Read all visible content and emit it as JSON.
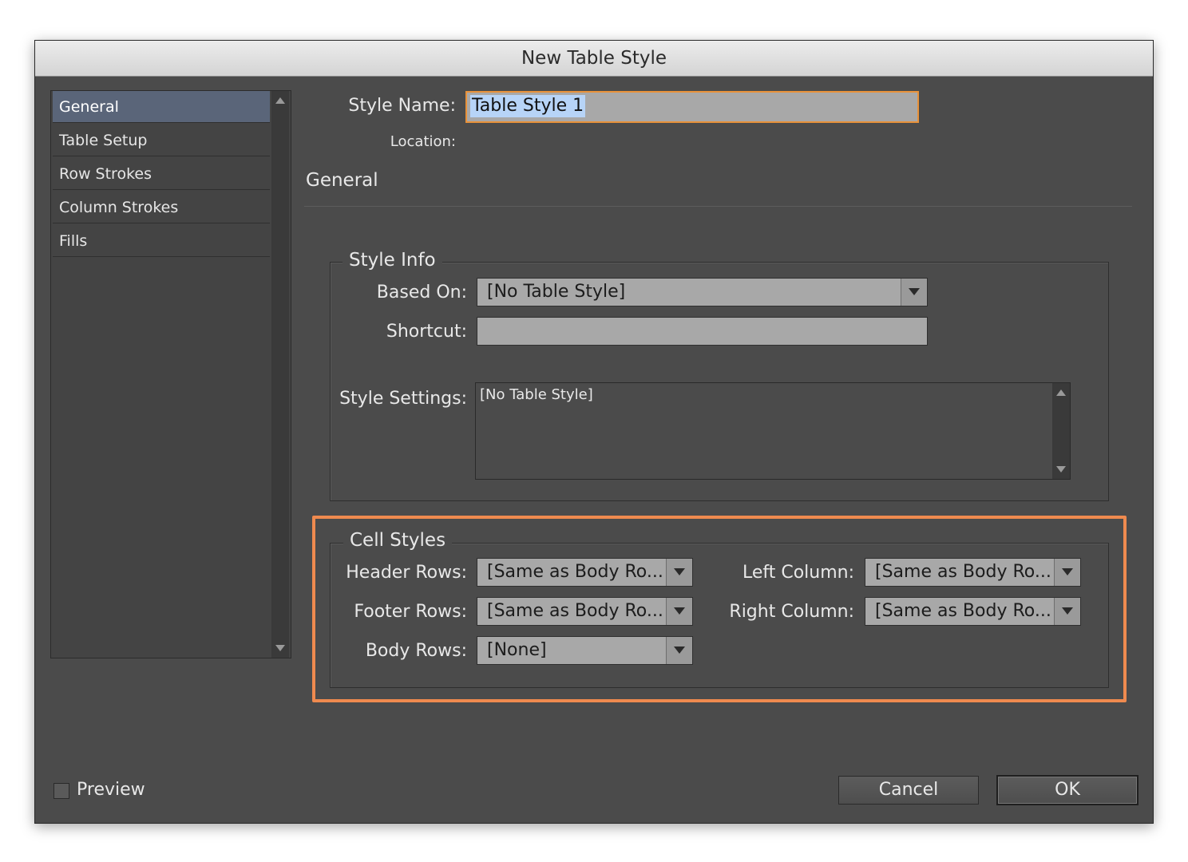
{
  "window": {
    "title": "New Table Style"
  },
  "sidebar": {
    "items": [
      {
        "label": "General",
        "active": true
      },
      {
        "label": "Table Setup"
      },
      {
        "label": "Row Strokes"
      },
      {
        "label": "Column Strokes"
      },
      {
        "label": "Fills"
      }
    ]
  },
  "style_name": {
    "label": "Style Name:",
    "value": "Table Style 1"
  },
  "location": {
    "label": "Location:"
  },
  "section": {
    "title": "General"
  },
  "style_info": {
    "legend": "Style Info",
    "based_on_label": "Based On:",
    "based_on_value": "[No Table Style]",
    "shortcut_label": "Shortcut:",
    "shortcut_value": "",
    "settings_label": "Style Settings:",
    "settings_value": "[No Table Style]"
  },
  "cell_styles": {
    "legend": "Cell Styles",
    "header_rows_label": "Header Rows:",
    "header_rows_value": "[Same as Body Ro...",
    "footer_rows_label": "Footer Rows:",
    "footer_rows_value": "[Same as Body Ro...",
    "body_rows_label": "Body Rows:",
    "body_rows_value": "[None]",
    "left_column_label": "Left Column:",
    "left_column_value": "[Same as Body Ro...",
    "right_column_label": "Right Column:",
    "right_column_value": "[Same as Body Ro..."
  },
  "footer": {
    "preview_label": "Preview",
    "preview_checked": false,
    "cancel_label": "Cancel",
    "ok_label": "OK"
  },
  "colors": {
    "highlight": "#ef8a4f",
    "focus": "#e8923a",
    "selection": "#b7d4f7"
  }
}
